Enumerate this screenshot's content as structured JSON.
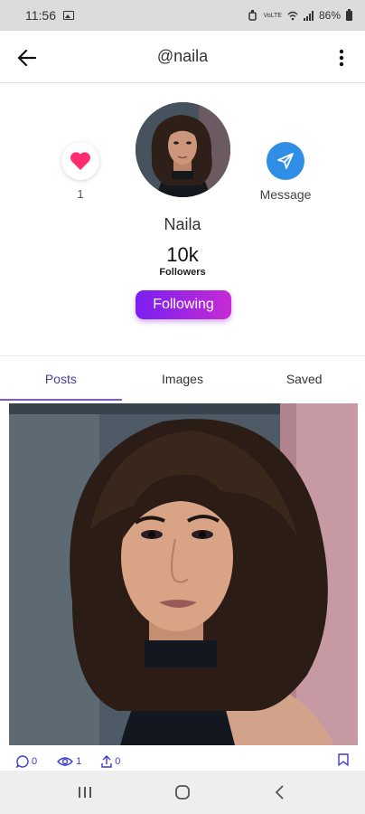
{
  "status_bar": {
    "time": "11:56",
    "battery": "86%",
    "network": "VoLTE"
  },
  "header": {
    "title": "@naila"
  },
  "profile": {
    "likes": "1",
    "message_label": "Message",
    "name": "Naila",
    "followers_count": "10k",
    "followers_label": "Followers",
    "follow_button": "Following"
  },
  "tabs": [
    {
      "label": "Posts",
      "active": true
    },
    {
      "label": "Images",
      "active": false
    },
    {
      "label": "Saved",
      "active": false
    }
  ],
  "post": {
    "comments": "0",
    "views": "1",
    "shares": "0"
  },
  "colors": {
    "accent": "#7a1ff0",
    "accent_end": "#c62bd4",
    "heart": "#ff2d6f",
    "message": "#2f8fe6"
  },
  "icons": [
    "back-arrow-icon",
    "more-vert-icon",
    "heart-icon",
    "send-icon",
    "comment-icon",
    "eye-icon",
    "share-icon",
    "bookmark-icon"
  ]
}
